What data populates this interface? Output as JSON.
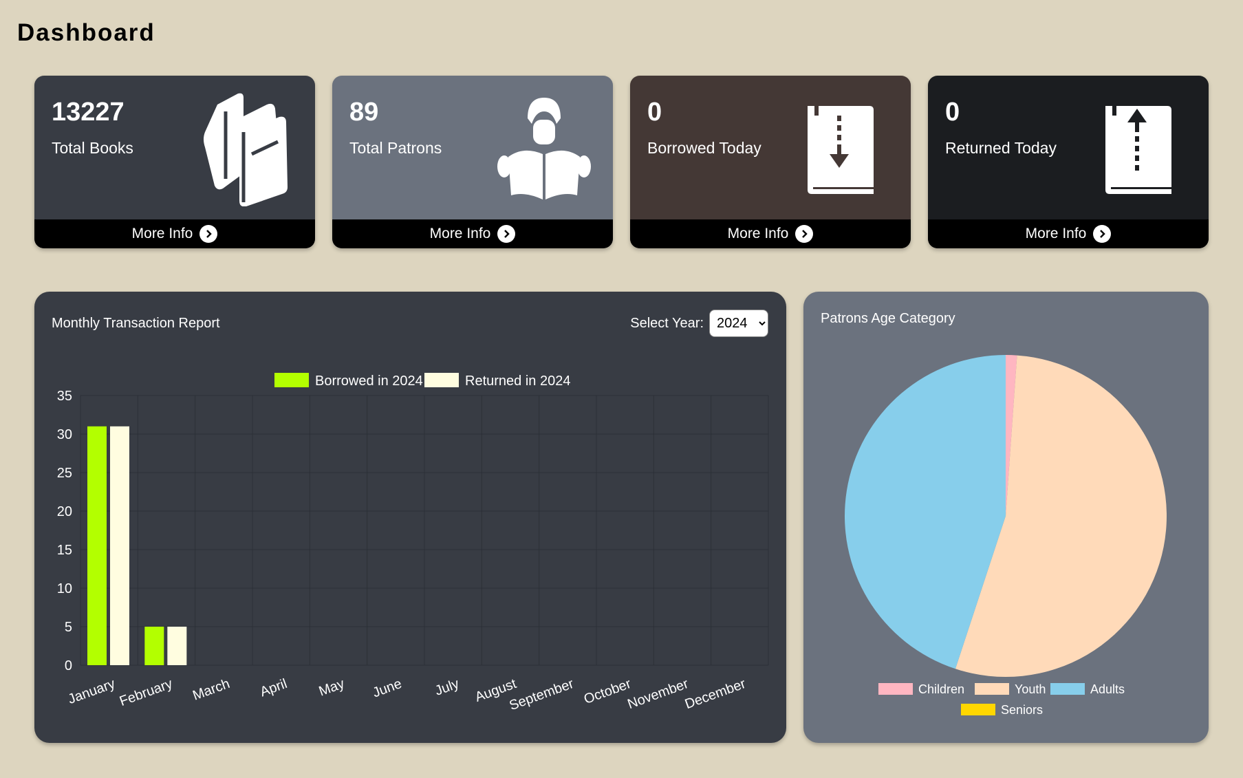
{
  "header": {
    "title": "Dashboard"
  },
  "cards": [
    {
      "count": "13227",
      "label": "Total Books",
      "more": "More Info",
      "icon": "books-icon",
      "color": "#383c44"
    },
    {
      "count": "89",
      "label": "Total Patrons",
      "more": "More Info",
      "icon": "reader-icon",
      "color": "#6b727e"
    },
    {
      "count": "0",
      "label": "Borrowed Today",
      "more": "More Info",
      "icon": "book-download-icon",
      "color": "#443835"
    },
    {
      "count": "0",
      "label": "Returned Today",
      "more": "More Info",
      "icon": "book-upload-icon",
      "color": "#1b1d20"
    }
  ],
  "transactions": {
    "title": "Monthly Transaction Report",
    "year_label": "Select Year:",
    "year_value": "2024",
    "year_options": [
      "2024"
    ]
  },
  "age_panel": {
    "title": "Patrons Age Category"
  },
  "chart_data": [
    {
      "type": "bar",
      "categories": [
        "January",
        "February",
        "March",
        "April",
        "May",
        "June",
        "July",
        "August",
        "September",
        "October",
        "November",
        "December"
      ],
      "series": [
        {
          "name": "Borrowed in 2024",
          "color": "#b3ff00",
          "values": [
            31,
            5,
            0,
            0,
            0,
            0,
            0,
            0,
            0,
            0,
            0,
            0
          ]
        },
        {
          "name": "Returned in 2024",
          "color": "#fffde0",
          "values": [
            31,
            5,
            0,
            0,
            0,
            0,
            0,
            0,
            0,
            0,
            0,
            0
          ]
        }
      ],
      "yticks": [
        "0",
        "5",
        "10",
        "15",
        "20",
        "25",
        "30",
        "35"
      ],
      "ylim": [
        0,
        35
      ],
      "grid": true,
      "legend": "top"
    },
    {
      "type": "pie",
      "labels": [
        "Children",
        "Youth",
        "Adults",
        "Seniors"
      ],
      "values": [
        1,
        48,
        40,
        0
      ],
      "colors": [
        "#ffb6c1",
        "#ffdab9",
        "#87ceeb",
        "#ffd700"
      ],
      "legend": "bottom"
    }
  ]
}
